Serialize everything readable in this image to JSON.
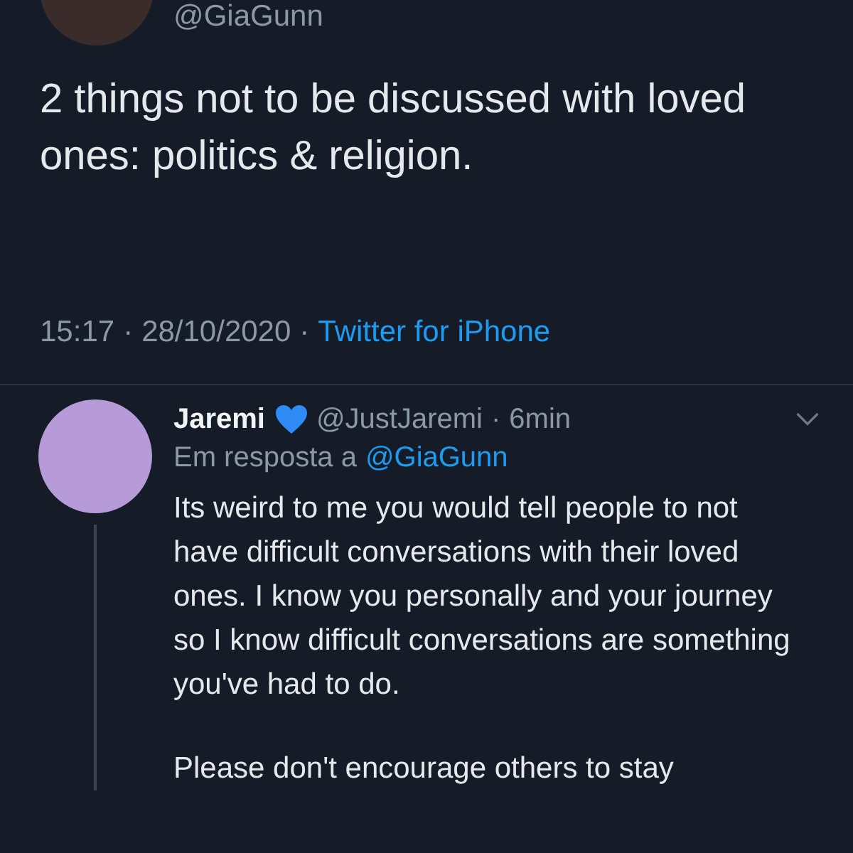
{
  "tweet": {
    "handle": "@GiaGunn",
    "text": "2 things not to be discussed with loved ones: politics & religion.",
    "time": "15:17",
    "separator": "·",
    "date": "28/10/2020",
    "separator_2": "·",
    "source": "Twitter for iPhone"
  },
  "reply": {
    "name": "Jaremi",
    "handle": "@JustJaremi",
    "separator": "·",
    "age": "6min",
    "in_reply_prefix": "Em resposta a",
    "in_reply_to": "@GiaGunn",
    "paragraphs": [
      "Its weird to me you would tell people to not have difficult conversations with their loved ones. I know you personally and your journey so I know difficult conversations are something you've had to do.",
      "Please don't encourage others to stay"
    ]
  }
}
